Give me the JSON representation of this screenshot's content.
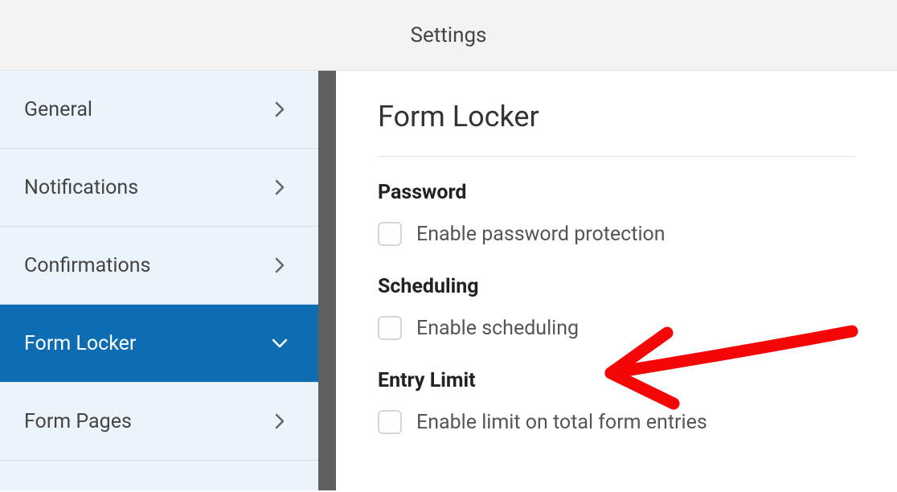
{
  "header": {
    "title": "Settings"
  },
  "sidebar": {
    "items": [
      {
        "label": "General"
      },
      {
        "label": "Notifications"
      },
      {
        "label": "Confirmations"
      },
      {
        "label": "Form Locker"
      },
      {
        "label": "Form Pages"
      }
    ]
  },
  "main": {
    "title": "Form Locker",
    "sections": [
      {
        "heading": "Password",
        "checkbox_label": "Enable password protection"
      },
      {
        "heading": "Scheduling",
        "checkbox_label": "Enable scheduling"
      },
      {
        "heading": "Entry Limit",
        "checkbox_label": "Enable limit on total form entries"
      }
    ]
  }
}
